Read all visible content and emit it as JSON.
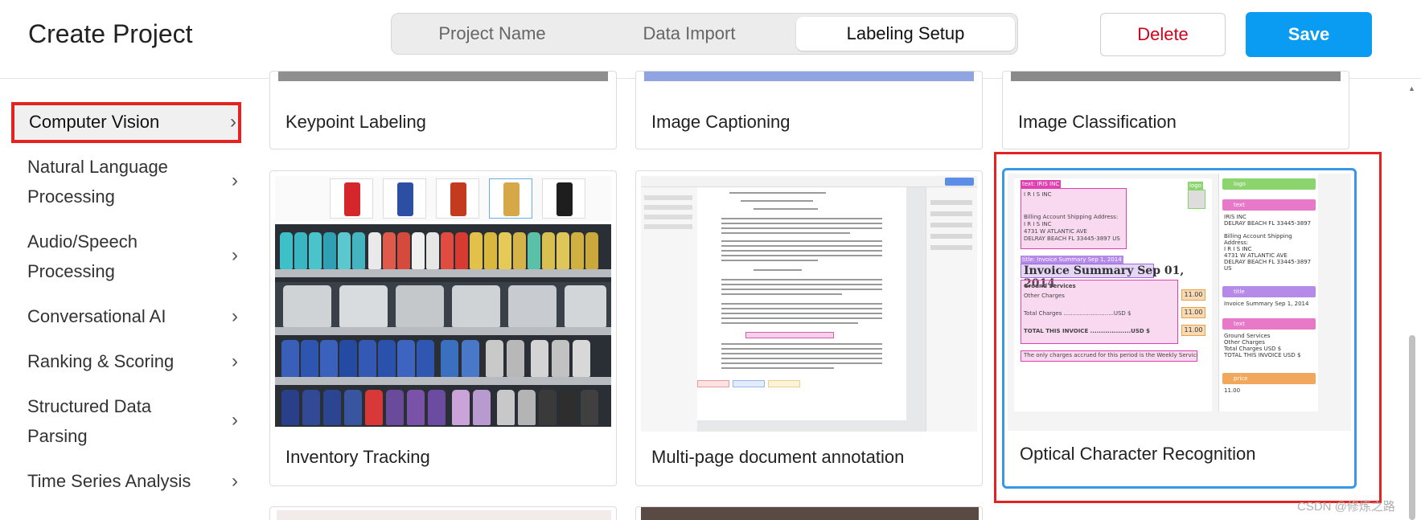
{
  "header": {
    "title": "Create Project",
    "steps": [
      "Project Name",
      "Data Import",
      "Labeling Setup"
    ],
    "active_step": "Labeling Setup",
    "delete_label": "Delete",
    "save_label": "Save"
  },
  "sidebar": {
    "items": [
      {
        "label": "Computer Vision",
        "active": true
      },
      {
        "label_line1": "Natural Language",
        "label_line2": "Processing"
      },
      {
        "label_line1": "Audio/Speech",
        "label_line2": "Processing"
      },
      {
        "label": "Conversational AI"
      },
      {
        "label": "Ranking & Scoring"
      },
      {
        "label_line1": "Structured Data",
        "label_line2": "Parsing"
      },
      {
        "label": "Time Series Analysis"
      }
    ]
  },
  "templates": {
    "row1": [
      "Keypoint Labeling",
      "Image Captioning",
      "Image Classification"
    ],
    "row2": [
      "Inventory Tracking",
      "Multi-page document annotation",
      "Optical Character Recognition"
    ]
  },
  "ocr_preview": {
    "company_lines": [
      "I R I S INC"
    ],
    "billing_lines": [
      "Billing Account Shipping Address:",
      "I R I S INC",
      "4731 W ATLANTIC AVE",
      "DELRAY BEACH FL 33445-3897 US"
    ],
    "invoice_title": "Invoice Summary Sep 01, 2014",
    "charges_lines": [
      "Ground Services",
      "Other Charges",
      "Total Charges ............................USD $",
      "TOTAL THIS INVOICE ...................USD $"
    ],
    "prices": [
      "11.00",
      "11.00",
      "11.00"
    ],
    "note": "The only charges accrued for this period is the Weekly Service Charge.",
    "panel": [
      {
        "tag": "logo",
        "id": "wed420",
        "color": "#8bd46e",
        "body": ""
      },
      {
        "tag": "text",
        "id": "qwe345",
        "color": "#e879c8",
        "body": "IRIS INC\nDELRAY BEACH FL 33445-3897\n\nBilling Account Shipping Address:\nI R I S INC\n4731 W ATLANTIC AVE\nDELRAY BEACH FL 33445-3897\nUS"
      },
      {
        "tag": "title",
        "id": "kab269",
        "color": "#b58ae8",
        "body": "Invoice Summary Sep 1, 2014"
      },
      {
        "tag": "text",
        "id": "cat181",
        "color": "#e879c8",
        "body": "Ground Services\nOther Charges\nTotal Charges USD $\nTOTAL THIS INVOICE USD $"
      },
      {
        "tag": "price",
        "id": "pcp177",
        "color": "#f2a85c",
        "body": "11.00"
      }
    ]
  },
  "watermark": "CSDN @修炼之路",
  "colors": {
    "accent": "#0a9bf2",
    "danger": "#d0021b",
    "highlight_red": "#e52222",
    "selected_blue": "#3a97e6"
  }
}
